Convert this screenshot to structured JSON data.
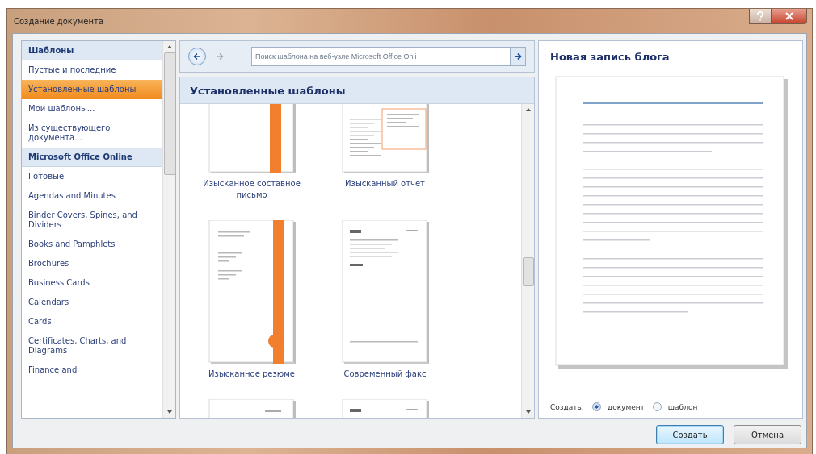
{
  "window": {
    "title": "Создание документа"
  },
  "sidebar": {
    "items": [
      {
        "kind": "header",
        "label": "Шаблоны"
      },
      {
        "kind": "item",
        "label": "Пустые и последние",
        "selected": false
      },
      {
        "kind": "item",
        "label": "Установленные шаблоны",
        "selected": true
      },
      {
        "kind": "item",
        "label": "Мои шаблоны...",
        "selected": false
      },
      {
        "kind": "item",
        "label": "Из существующего документа...",
        "selected": false
      },
      {
        "kind": "header",
        "label": "Microsoft Office Online"
      },
      {
        "kind": "item",
        "label": "Готовые",
        "selected": false
      },
      {
        "kind": "item",
        "label": "Agendas and Minutes",
        "selected": false
      },
      {
        "kind": "item",
        "label": "Binder Covers, Spines, and Dividers",
        "selected": false
      },
      {
        "kind": "item",
        "label": "Books and Pamphlets",
        "selected": false
      },
      {
        "kind": "item",
        "label": "Brochures",
        "selected": false
      },
      {
        "kind": "item",
        "label": "Business Cards",
        "selected": false
      },
      {
        "kind": "item",
        "label": "Calendars",
        "selected": false
      },
      {
        "kind": "item",
        "label": "Cards",
        "selected": false
      },
      {
        "kind": "item",
        "label": "Certificates, Charts, and Diagrams",
        "selected": false
      },
      {
        "kind": "item",
        "label": "Finance and",
        "selected": false
      }
    ]
  },
  "nav": {
    "back": {
      "disabled": false
    },
    "forward": {
      "disabled": true
    }
  },
  "search": {
    "placeholder": "Поиск шаблона на веб-узле Microsoft Office Onli"
  },
  "gallery": {
    "title": "Установленные шаблоны",
    "templates": [
      {
        "kind": "letter",
        "label": "Изысканное составное письмо"
      },
      {
        "kind": "report",
        "label": "Изысканный отчет"
      },
      {
        "kind": "resume",
        "label": "Изысканное резюме"
      },
      {
        "kind": "fax",
        "label": "Современный факс"
      },
      {
        "kind": "memo"
      },
      {
        "kind": "fax"
      }
    ]
  },
  "preview": {
    "title": "Новая запись блога"
  },
  "create_as": {
    "label": "Создать:",
    "options": [
      {
        "label": "документ",
        "selected": true
      },
      {
        "label": "шаблон",
        "selected": false
      }
    ]
  },
  "buttons": [
    {
      "label": "Создать",
      "default": true
    },
    {
      "label": "Отмена",
      "default": false
    }
  ]
}
